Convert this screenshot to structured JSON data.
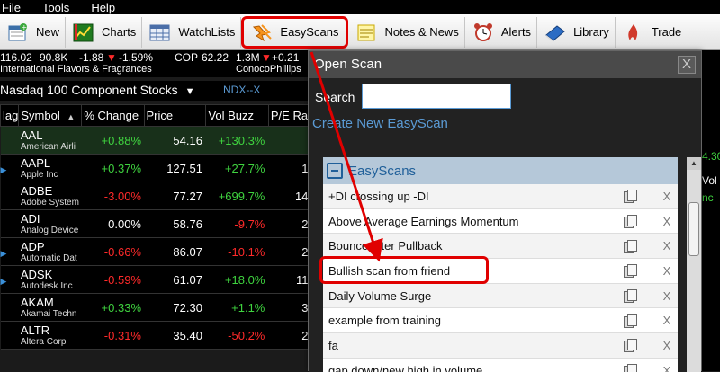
{
  "menu": {
    "items": [
      "File",
      "Tools",
      "Help"
    ]
  },
  "toolbar": {
    "items": [
      {
        "label": "New",
        "icon": "new-list-icon"
      },
      {
        "label": "Charts",
        "icon": "charts-icon"
      },
      {
        "label": "WatchLists",
        "icon": "watchlists-icon"
      },
      {
        "label": "EasyScans",
        "icon": "easyscans-icon"
      },
      {
        "label": "Notes & News",
        "icon": "notes-icon"
      },
      {
        "label": "Alerts",
        "icon": "alarm-clock-icon"
      },
      {
        "label": "Library",
        "icon": "library-icon"
      },
      {
        "label": "Trade",
        "icon": "trade-icon"
      }
    ]
  },
  "ticker": {
    "iff": {
      "price": "116.02",
      "vol": "90.8K",
      "chg": "-1.88",
      "arrow": "▼",
      "pct": "-1.59%",
      "name": "International Flavors & Fragrances"
    },
    "cop": {
      "symbol": "COP",
      "price": "62.22",
      "vol": "1.3M",
      "arrow": "▼",
      "chg": "+0.21",
      "name": "ConocoPhillips"
    }
  },
  "watchlist": {
    "title": "Nasdaq 100 Component Stocks",
    "dropdown_arrow": "▼",
    "symbol_tag": "NDX--X",
    "columns": [
      "lag",
      "Symbol",
      "% Change",
      "Price",
      "Vol Buzz",
      "P/E Ra"
    ],
    "rows": [
      {
        "symbol": "AAL",
        "company": "American Airli",
        "pct": "+0.88%",
        "price": "54.16",
        "vb": "+130.3%",
        "pe": ""
      },
      {
        "symbol": "AAPL",
        "company": "Apple Inc",
        "pct": "+0.37%",
        "price": "127.51",
        "vb": "+27.7%",
        "pe": "1"
      },
      {
        "symbol": "ADBE",
        "company": "Adobe System",
        "pct": "-3.00%",
        "price": "77.27",
        "vb": "+699.7%",
        "pe": "14"
      },
      {
        "symbol": "ADI",
        "company": "Analog Device",
        "pct": "0.00%",
        "price": "58.76",
        "vb": "-9.7%",
        "pe": "2"
      },
      {
        "symbol": "ADP",
        "company": "Automatic Dat",
        "pct": "-0.66%",
        "price": "86.07",
        "vb": "-10.1%",
        "pe": "2"
      },
      {
        "symbol": "ADSK",
        "company": "Autodesk Inc",
        "pct": "-0.59%",
        "price": "61.07",
        "vb": "+18.0%",
        "pe": "11"
      },
      {
        "symbol": "AKAM",
        "company": "Akamai Techn",
        "pct": "+0.33%",
        "price": "72.30",
        "vb": "+1.1%",
        "pe": "3"
      },
      {
        "symbol": "ALTR",
        "company": "Altera Corp",
        "pct": "-0.31%",
        "price": "35.40",
        "vb": "-50.2%",
        "pe": "2"
      }
    ]
  },
  "dialog": {
    "title": "Open Scan",
    "close": "X",
    "search_label": "Search",
    "search_value": "",
    "create_link": "Create New EasyScan",
    "group_label": "EasyScans",
    "scans": [
      "+DI crossing up -DI",
      "Above Average Earnings Momentum",
      "Bounce after Pullback",
      "Bullish scan from friend",
      "Daily Volume Surge",
      "example from training",
      "fa",
      "gap down/new high in volume"
    ],
    "delete_mark": "X",
    "scroll_up": "▲"
  },
  "right_panel": {
    "t1": "4.30",
    "t2": "Vol",
    "t3": "nc"
  },
  "colors": {
    "positive": "#3fd33f",
    "negative": "#ff2a2a",
    "link": "#5b9bd5",
    "highlight": "#e00000"
  }
}
